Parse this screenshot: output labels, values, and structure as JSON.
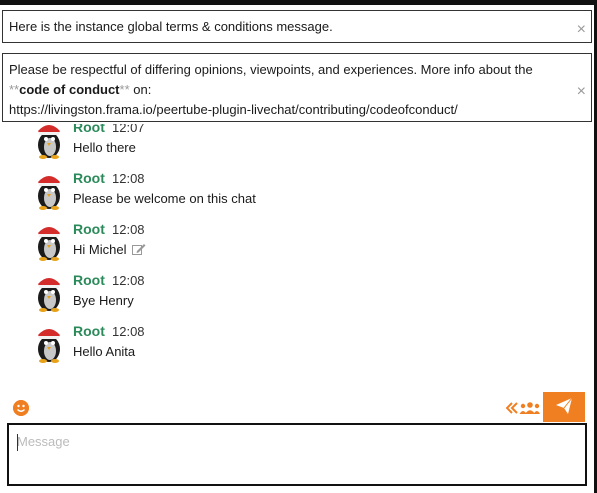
{
  "banners": {
    "terms": {
      "text": "Here is the instance global terms & conditions message.",
      "close_symbol": "×"
    },
    "conduct": {
      "line1": "Please be respectful of differing opinions, viewpoints, and experiences. More info about the",
      "mark_open": "**",
      "bold_text": "code of conduct",
      "mark_close": "**",
      "suffix": " on:",
      "url": "https://livingston.frama.io/peertube-plugin-livechat/contributing/codeofconduct/",
      "close_symbol": "×"
    }
  },
  "messages": [
    {
      "nick": "Root",
      "time": "12:07",
      "text": "Hello there",
      "edited": false
    },
    {
      "nick": "Root",
      "time": "12:08",
      "text": "Please be welcome on this chat",
      "edited": false
    },
    {
      "nick": "Root",
      "time": "12:08",
      "text": "Hi Michel",
      "edited": true
    },
    {
      "nick": "Root",
      "time": "12:08",
      "text": "Bye Henry",
      "edited": false
    },
    {
      "nick": "Root",
      "time": "12:08",
      "text": "Hello Anita",
      "edited": false
    }
  ],
  "composer": {
    "placeholder": "Message"
  },
  "icons": {
    "emoji": "smiley-icon",
    "occupants": "occupants-icon",
    "send": "paper-plane-icon",
    "edited": "pencil-edit-icon",
    "avatar": "penguin-avatar"
  },
  "colors": {
    "accent": "#f07f22",
    "nick": "#2b8a5a",
    "border": "#111111"
  }
}
